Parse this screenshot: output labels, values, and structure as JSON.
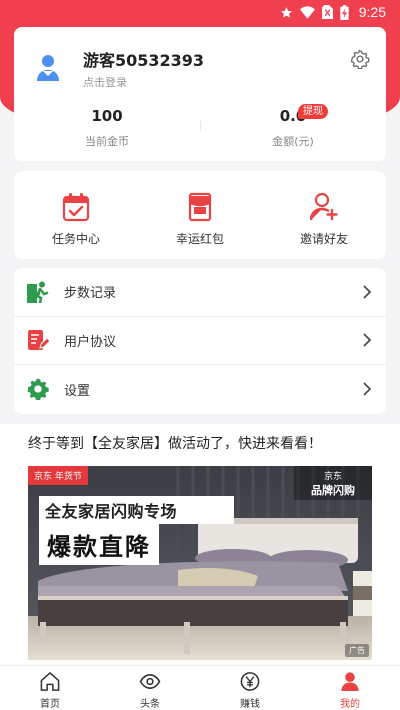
{
  "status_bar": {
    "time": "9:25"
  },
  "profile": {
    "username": "游客50532393",
    "login_hint": "点击登录",
    "coins_value": "100",
    "coins_label": "当前金币",
    "balance_value": "0.0",
    "balance_label": "金额(元)",
    "withdraw_tag": "提现"
  },
  "features": [
    {
      "label": "任务中心",
      "icon": "task-calendar-icon"
    },
    {
      "label": "幸运红包",
      "icon": "red-envelope-icon"
    },
    {
      "label": "邀请好友",
      "icon": "invite-user-icon"
    }
  ],
  "menu_list": [
    {
      "label": "步数记录",
      "icon": "walking-person-icon"
    },
    {
      "label": "用户协议",
      "icon": "document-edit-icon"
    },
    {
      "label": "设置",
      "icon": "gear-icon"
    }
  ],
  "promo": {
    "title": "终于等到【全友家居】做活动了，快进来看看！",
    "ad": {
      "brand_tag": "京东 年货节",
      "jd_top": "京东",
      "jd_main": "品牌闪购",
      "headline1": "全友家居闪购专场",
      "headline2": "爆款直降",
      "badge": "广告"
    }
  },
  "tabs": [
    {
      "label": "首页",
      "icon": "home-icon",
      "active": false
    },
    {
      "label": "头条",
      "icon": "eye-icon",
      "active": false
    },
    {
      "label": "赚钱",
      "icon": "yen-coin-icon",
      "active": false
    },
    {
      "label": "我的",
      "icon": "profile-icon",
      "active": true
    }
  ],
  "colors": {
    "accent": "#f0404f",
    "active_tab": "#e94244",
    "tag": "#f03b3b",
    "settings_green": "#2e9b4f"
  }
}
